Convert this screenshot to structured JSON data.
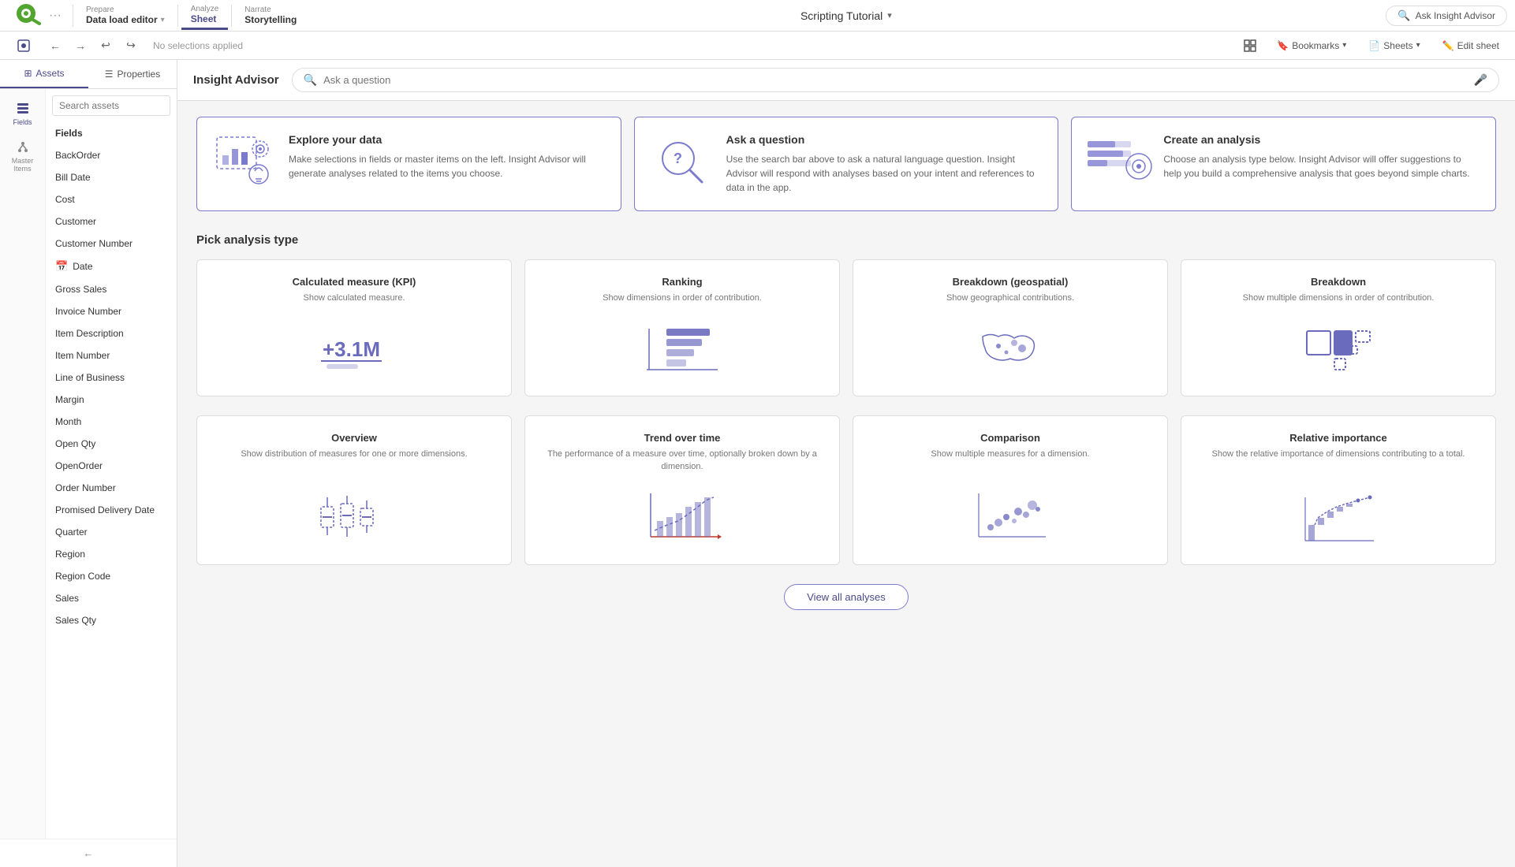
{
  "topNav": {
    "logo": "Qlik",
    "logoDots": "···",
    "sections": [
      {
        "id": "prepare",
        "sublabel": "Prepare",
        "label": "Data load editor",
        "active": false
      },
      {
        "id": "analyze",
        "sublabel": "Analyze",
        "label": "Sheet",
        "active": true
      },
      {
        "id": "narrate",
        "sublabel": "Narrate",
        "label": "Storytelling",
        "active": false
      }
    ],
    "appTitle": "Scripting Tutorial",
    "askInsightLabel": "Ask Insight Advisor"
  },
  "toolbar": {
    "noSelections": "No selections applied",
    "bookmarks": "Bookmarks",
    "sheets": "Sheets",
    "editSheet": "Edit sheet"
  },
  "sidebar": {
    "tabs": [
      {
        "id": "assets",
        "label": "Assets",
        "active": true
      },
      {
        "id": "properties",
        "label": "Properties",
        "active": false
      }
    ],
    "sections": [
      {
        "id": "fields",
        "label": "Fields",
        "active": true
      },
      {
        "id": "master-items",
        "label": "Master Items",
        "active": false
      }
    ],
    "searchPlaceholder": "Search assets",
    "fields": [
      {
        "id": "fields-header",
        "label": "Fields",
        "type": "header"
      },
      {
        "id": "backorder",
        "label": "BackOrder",
        "type": "field"
      },
      {
        "id": "bill-date",
        "label": "Bill Date",
        "type": "field"
      },
      {
        "id": "cost",
        "label": "Cost",
        "type": "field"
      },
      {
        "id": "customer",
        "label": "Customer",
        "type": "field"
      },
      {
        "id": "customer-number",
        "label": "Customer Number",
        "type": "field"
      },
      {
        "id": "date",
        "label": "Date",
        "type": "calendar"
      },
      {
        "id": "gross-sales",
        "label": "Gross Sales",
        "type": "field"
      },
      {
        "id": "invoice-number",
        "label": "Invoice Number",
        "type": "field"
      },
      {
        "id": "item-description",
        "label": "Item Description",
        "type": "field"
      },
      {
        "id": "item-number",
        "label": "Item Number",
        "type": "field"
      },
      {
        "id": "line-of-business",
        "label": "Line of Business",
        "type": "field"
      },
      {
        "id": "margin",
        "label": "Margin",
        "type": "field"
      },
      {
        "id": "month",
        "label": "Month",
        "type": "field"
      },
      {
        "id": "open-qty",
        "label": "Open Qty",
        "type": "field"
      },
      {
        "id": "open-order",
        "label": "OpenOrder",
        "type": "field"
      },
      {
        "id": "order-number",
        "label": "Order Number",
        "type": "field"
      },
      {
        "id": "promised-delivery-date",
        "label": "Promised Delivery Date",
        "type": "field"
      },
      {
        "id": "quarter",
        "label": "Quarter",
        "type": "field"
      },
      {
        "id": "region",
        "label": "Region",
        "type": "field"
      },
      {
        "id": "region-code",
        "label": "Region Code",
        "type": "field"
      },
      {
        "id": "sales",
        "label": "Sales",
        "type": "field"
      },
      {
        "id": "sales-qty",
        "label": "Sales Qty",
        "type": "field"
      }
    ]
  },
  "insightAdvisor": {
    "title": "Insight Advisor",
    "searchPlaceholder": "Ask a question",
    "cards": [
      {
        "id": "explore",
        "title": "Explore your data",
        "description": "Make selections in fields or master items on the left. Insight Advisor will generate analyses related to the items you choose."
      },
      {
        "id": "ask",
        "title": "Ask a question",
        "description": "Use the search bar above to ask a natural language question. Insight Advisor will respond with analyses based on your intent and references to data in the app."
      },
      {
        "id": "create-analysis",
        "title": "Create an analysis",
        "description": "Choose an analysis type below. Insight Advisor will offer suggestions to help you build a comprehensive analysis that goes beyond simple charts."
      }
    ],
    "sectionTitle": "Pick analysis type",
    "analyses": [
      {
        "id": "kpi",
        "title": "Calculated measure (KPI)",
        "description": "Show calculated measure.",
        "chartType": "kpi"
      },
      {
        "id": "ranking",
        "title": "Ranking",
        "description": "Show dimensions in order of contribution.",
        "chartType": "ranking"
      },
      {
        "id": "breakdown-geo",
        "title": "Breakdown (geospatial)",
        "description": "Show geographical contributions.",
        "chartType": "geo"
      },
      {
        "id": "breakdown",
        "title": "Breakdown",
        "description": "Show multiple dimensions in order of contribution.",
        "chartType": "treemap"
      },
      {
        "id": "overview",
        "title": "Overview",
        "description": "Show distribution of measures for one or more dimensions.",
        "chartType": "boxplot"
      },
      {
        "id": "trend",
        "title": "Trend over time",
        "description": "The performance of a measure over time, optionally broken down by a dimension.",
        "chartType": "trend"
      },
      {
        "id": "comparison",
        "title": "Comparison",
        "description": "Show multiple measures for a dimension.",
        "chartType": "scatter"
      },
      {
        "id": "relative",
        "title": "Relative importance",
        "description": "Show the relative importance of dimensions contributing to a total.",
        "chartType": "waterfall"
      }
    ],
    "viewAllLabel": "View all analyses"
  },
  "colors": {
    "accent": "#4A4A8A",
    "accentLight": "#7B7BCE",
    "green": "#52A52E",
    "chartBlue": "#6B6BBE",
    "chartRed": "#C0392B"
  }
}
